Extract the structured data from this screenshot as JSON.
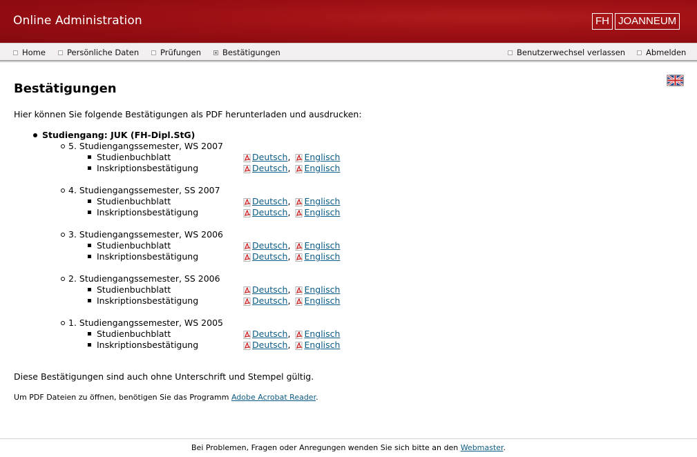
{
  "header": {
    "app_title": "Online Administration",
    "logo_left": "FH",
    "logo_right": "JOANNEUM",
    "background_color": "#9c0f14"
  },
  "nav": {
    "left_items": [
      "Home",
      "Persönliche Daten",
      "Prüfungen",
      "Bestätigungen"
    ],
    "active_item": "Bestätigungen",
    "right_items": [
      "Benutzerwechsel verlassen",
      "Abmelden"
    ]
  },
  "language_switch": {
    "icon": "uk-flag-icon"
  },
  "main": {
    "title": "Bestätigungen",
    "intro": "Hier können Sie folgende Bestätigungen als PDF herunterladen und ausdrucken:",
    "program": "Studiengang: JUK (FH-Dipl.StG)",
    "semesters": [
      {
        "title": "5. Studiengangssemester, WS 2007",
        "documents": [
          {
            "name": "Studienbuchblatt",
            "links": [
              "Deutsch",
              "Englisch"
            ]
          },
          {
            "name": "Inskriptionsbestätigung",
            "links": [
              "Deutsch",
              "Englisch"
            ]
          }
        ]
      },
      {
        "title": "4. Studiengangssemester, SS 2007",
        "documents": [
          {
            "name": "Studienbuchblatt",
            "links": [
              "Deutsch",
              "Englisch"
            ]
          },
          {
            "name": "Inskriptionsbestätigung",
            "links": [
              "Deutsch",
              "Englisch"
            ]
          }
        ]
      },
      {
        "title": "3. Studiengangssemester, WS 2006",
        "documents": [
          {
            "name": "Studienbuchblatt",
            "links": [
              "Deutsch",
              "Englisch"
            ]
          },
          {
            "name": "Inskriptionsbestätigung",
            "links": [
              "Deutsch",
              "Englisch"
            ]
          }
        ]
      },
      {
        "title": "2. Studiengangssemester, SS 2006",
        "documents": [
          {
            "name": "Studienbuchblatt",
            "links": [
              "Deutsch",
              "Englisch"
            ]
          },
          {
            "name": "Inskriptionsbestätigung",
            "links": [
              "Deutsch",
              "Englisch"
            ]
          }
        ]
      },
      {
        "title": "1. Studiengangssemester, WS 2005",
        "documents": [
          {
            "name": "Studienbuchblatt",
            "links": [
              "Deutsch",
              "Englisch"
            ]
          },
          {
            "name": "Inskriptionsbestätigung",
            "links": [
              "Deutsch",
              "Englisch"
            ]
          }
        ]
      }
    ],
    "note": "Diese Bestätigungen sind auch ohne Unterschrift und Stempel gültig.",
    "pdf_note_prefix": "Um PDF Dateien zu öffnen, benötigen Sie das Programm ",
    "pdf_note_link": "Adobe Acrobat Reader",
    "pdf_note_suffix": "."
  },
  "footer": {
    "prefix": "Bei Problemen, Fragen oder Anregungen wenden Sie sich bitte an den ",
    "link": "Webmaster",
    "suffix": "."
  },
  "colors": {
    "link": "#0a5c86",
    "pdf_icon": "#cc1f1f"
  }
}
